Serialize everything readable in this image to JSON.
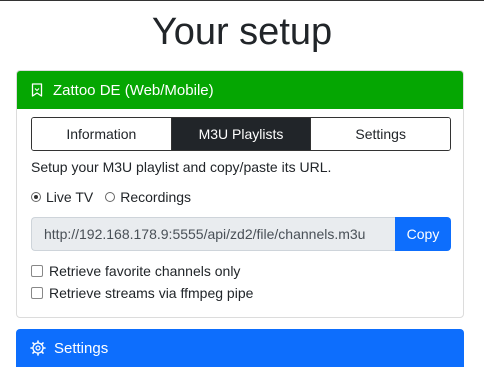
{
  "page": {
    "title": "Your setup"
  },
  "card": {
    "header": "Zattoo DE (Web/Mobile)",
    "tabs": [
      {
        "label": "Information",
        "active": false
      },
      {
        "label": "M3U Playlists",
        "active": true
      },
      {
        "label": "Settings",
        "active": false
      }
    ],
    "description": "Setup your M3U playlist and copy/paste its URL.",
    "radios": {
      "live_tv": {
        "label": "Live TV",
        "checked": true
      },
      "recordings": {
        "label": "Recordings",
        "checked": false
      }
    },
    "url": "http://192.168.178.9:5555/api/zd2/file/channels.m3u",
    "copy_label": "Copy",
    "checkboxes": [
      {
        "label": "Retrieve favorite channels only",
        "checked": false
      },
      {
        "label": "Retrieve streams via ffmpeg pipe",
        "checked": false
      }
    ]
  },
  "settings_section": {
    "label": "Settings"
  },
  "colors": {
    "header_green": "#05a602",
    "primary_blue": "#0d6efd",
    "dark": "#212529"
  },
  "icons": {
    "card_header": "bookmark-icon",
    "settings": "gear-icon"
  }
}
